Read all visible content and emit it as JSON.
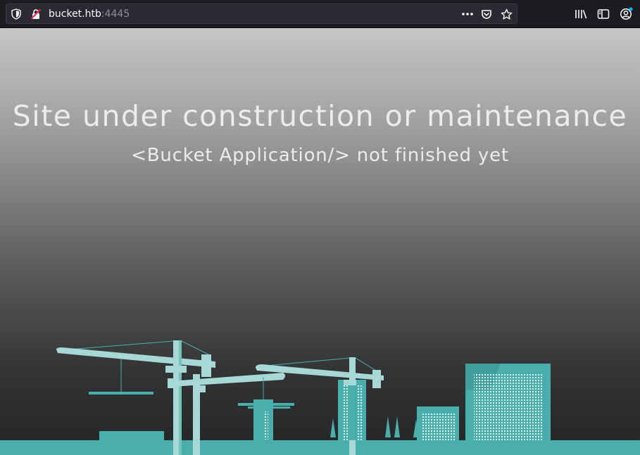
{
  "browser": {
    "url_host": "bucket.htb",
    "url_port": ":4445",
    "icons": {
      "tracking_protection": "shield-icon",
      "insecure_connection": "lock-slash-icon",
      "page_actions": "ellipsis-icon",
      "pocket": "pocket-icon",
      "bookmark": "star-icon",
      "library": "library-icon",
      "sidebar": "sidebar-icon",
      "account": "account-icon"
    }
  },
  "page": {
    "title": "Site under construction or maintenance",
    "subtitle": "<Bucket Application/> not finished yet"
  },
  "colors": {
    "accent_teal": "#4aaeac",
    "light_teal": "#a7d8d6",
    "heading_text": "#ececec"
  }
}
